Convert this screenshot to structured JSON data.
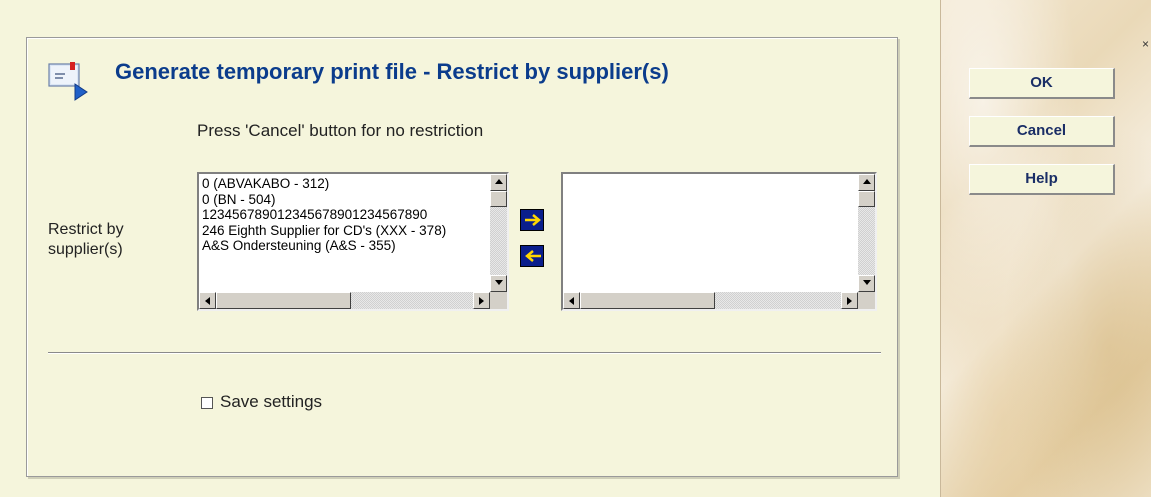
{
  "dialog": {
    "title": "Generate temporary print file - Restrict by supplier(s)",
    "hint": "Press 'Cancel' button for no restriction",
    "field_label_line1": "Restrict by",
    "field_label_line2": "supplier(s)",
    "save_settings_label": "Save settings",
    "save_settings_checked": false
  },
  "source_list": {
    "items": [
      "0 (ABVAKABO - 312)",
      "0 (BN - 504)",
      "123456789012345678901234567890",
      "246 Eighth Supplier for CD's (XXX - 378)",
      "A&S Ondersteuning (A&S - 355)"
    ]
  },
  "target_list": {
    "items": []
  },
  "buttons": {
    "ok": "OK",
    "cancel": "Cancel",
    "help": "Help",
    "close": "×"
  },
  "icons": {
    "title_icon": "envelope-arrow-icon",
    "move_right": "arrow-right-icon",
    "move_left": "arrow-left-icon"
  },
  "colors": {
    "background": "#f5f5dc",
    "title": "#0b3c8c",
    "move_button": "#0a1e8c",
    "arrow": "#ffd700"
  }
}
